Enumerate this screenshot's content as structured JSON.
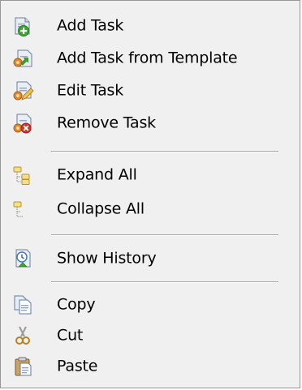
{
  "menu": {
    "items": [
      {
        "label": "Add Task",
        "icon": "add-task-icon"
      },
      {
        "label": "Add Task from Template",
        "icon": "add-task-template-icon"
      },
      {
        "label": "Edit Task",
        "icon": "edit-task-icon"
      },
      {
        "label": "Remove Task",
        "icon": "remove-task-icon"
      },
      {
        "label": "Expand All",
        "icon": "expand-all-icon"
      },
      {
        "label": "Collapse All",
        "icon": "collapse-all-icon"
      },
      {
        "label": "Show History",
        "icon": "history-icon"
      },
      {
        "label": "Copy",
        "icon": "copy-icon"
      },
      {
        "label": "Cut",
        "icon": "cut-icon"
      },
      {
        "label": "Paste",
        "icon": "paste-icon"
      }
    ]
  },
  "colors": {
    "menu_background": "#f0f0f0",
    "separator": "#a8a8a8",
    "border": "#979797"
  }
}
